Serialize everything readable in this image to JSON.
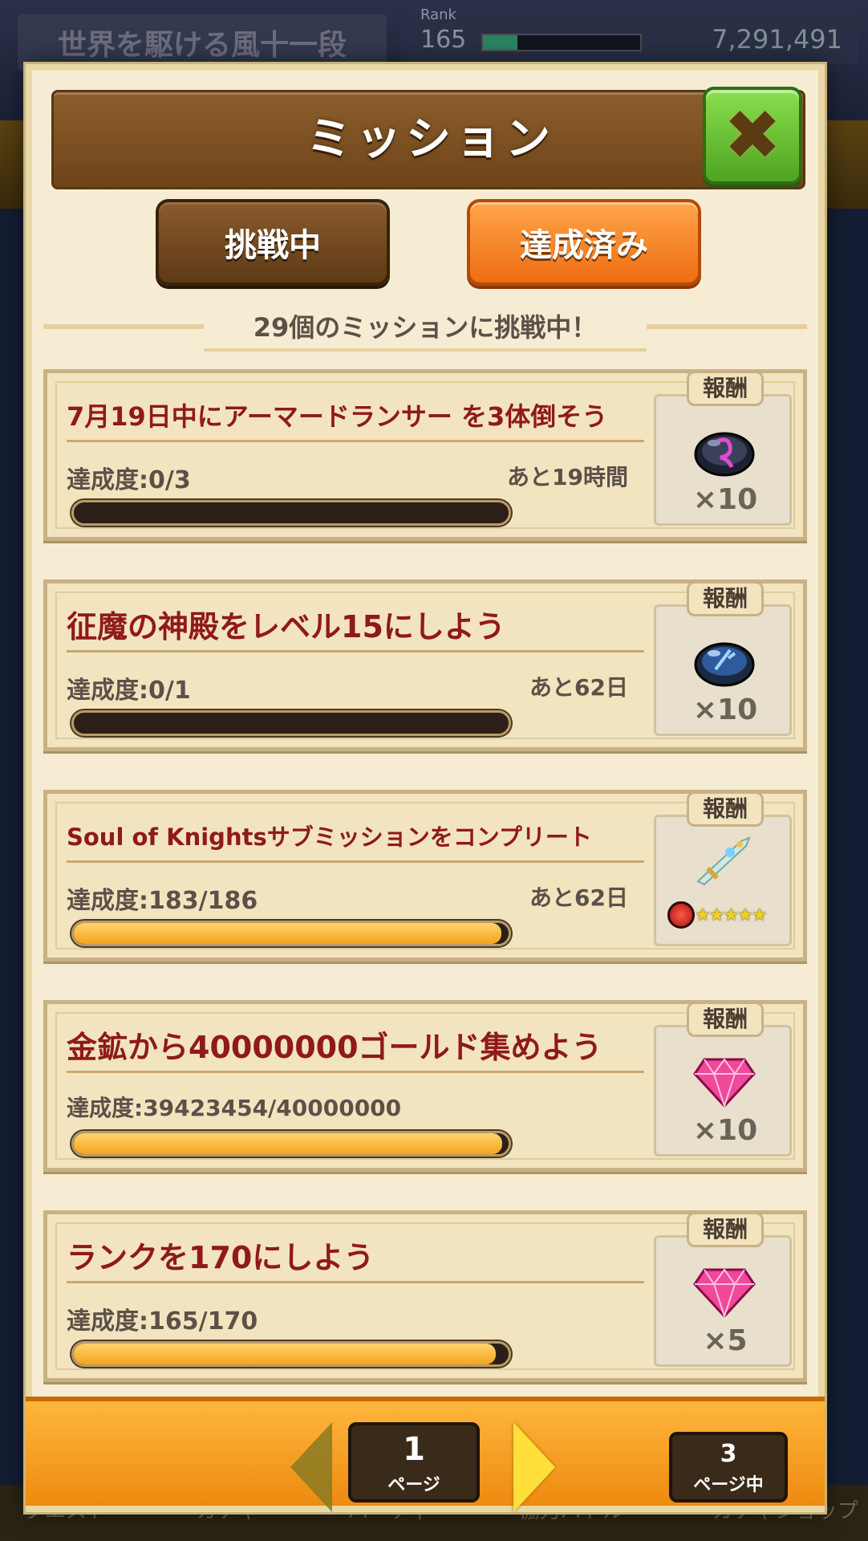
{
  "background": {
    "title": "世界を駆ける風十一段",
    "rank_label": "Rank",
    "rank_value": "165",
    "coins": "7,291,491",
    "bottom_nav": [
      "クエスト",
      "ガチャ",
      "パーティ",
      "協力バトル",
      "ガチャショップ"
    ]
  },
  "modal": {
    "title": "ミッション",
    "close_icon": "close-x-icon",
    "tabs": {
      "active": "挑戦中",
      "completed": "達成済み"
    },
    "status": "29個のミッションに挑戦中！",
    "reward_label": "報酬",
    "missions": [
      {
        "title": "7月19日中にアーマードランサー を3体倒そう",
        "progress": "達成度:0/3",
        "time_left": "あと19時間",
        "progress_fraction": 0.0,
        "reward_icon": "dark-orb-icon",
        "reward_qty": "×10"
      },
      {
        "title": "征魔の神殿をレベル15にしよう",
        "progress": "達成度:0/1",
        "time_left": "あと62日",
        "progress_fraction": 0.0,
        "reward_icon": "blue-orb-icon",
        "reward_qty": "×10"
      },
      {
        "title": "Soul of Knightsサブミッションをコンプリート",
        "progress": "達成度:183/186",
        "time_left": "あと62日",
        "progress_fraction": 0.984,
        "reward_icon": "sword-weapon-icon",
        "reward_rarity": "★★★★★"
      },
      {
        "title": "金鉱から40000000ゴールド集めよう",
        "progress": "達成度:39423454/40000000",
        "time_left": "",
        "progress_fraction": 0.986,
        "reward_icon": "pink-gem-icon",
        "reward_qty": "×10"
      },
      {
        "title": "ランクを170にしよう",
        "progress": "達成度:165/170",
        "time_left": "",
        "progress_fraction": 0.971,
        "reward_icon": "pink-gem-icon",
        "reward_qty": "×5"
      }
    ],
    "pager": {
      "current": "1",
      "current_unit": "ページ",
      "total": "3",
      "total_unit": "ページ中"
    }
  }
}
